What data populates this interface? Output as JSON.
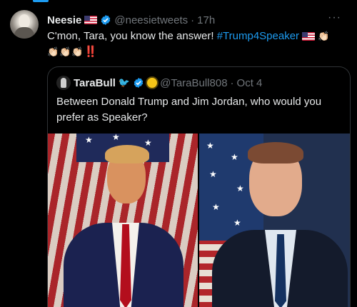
{
  "tweet": {
    "name": "Neesie",
    "handle": "@neesietweets",
    "separator": "·",
    "time": "17h",
    "more": "···",
    "text_before": "C'mon, Tara, you know the answer! ",
    "hashtag": "#Trump4Speaker",
    "claps": "👏🏻",
    "bangs": "‼️"
  },
  "quote": {
    "name": "TaraBull",
    "bird": "🐦",
    "handle": "@TaraBull808",
    "separator": "·",
    "date": "Oct 4",
    "text": "Between Donald Trump and Jim Jordan, who would you prefer as Speaker?"
  },
  "colors": {
    "background": "#000000",
    "accent": "#1d9bf0",
    "muted": "#71767b",
    "text": "#e7e9ea"
  },
  "icons": [
    "verified-badge-icon",
    "us-flag-icon",
    "more-icon",
    "bird-icon",
    "sun-icon"
  ]
}
